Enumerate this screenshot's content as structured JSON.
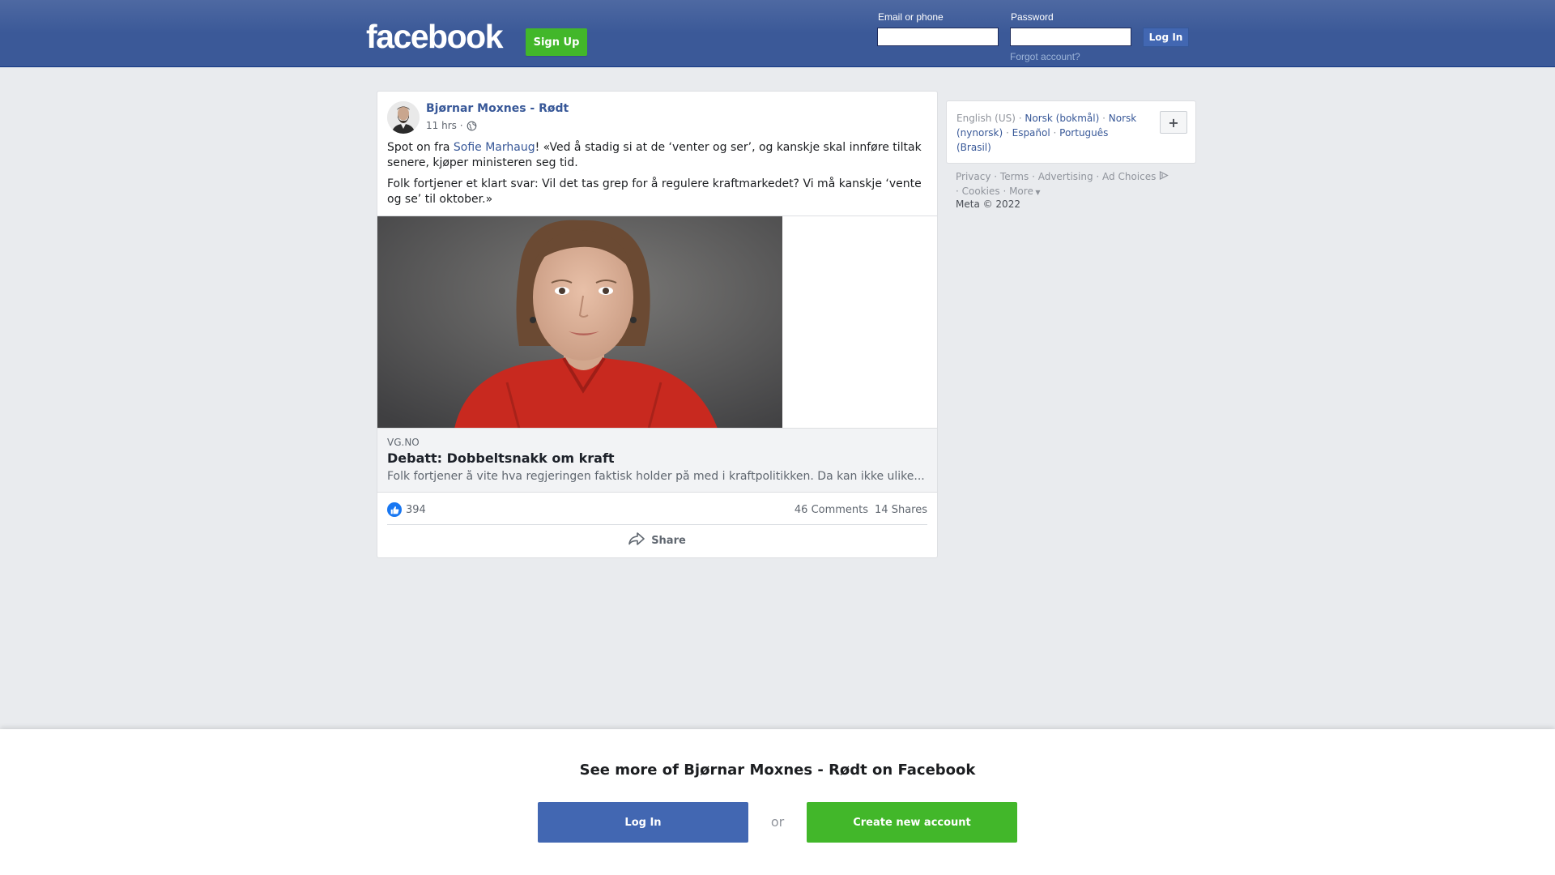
{
  "header": {
    "logo": "facebook",
    "signup_label": "Sign Up",
    "email_label": "Email or phone",
    "password_label": "Password",
    "login_label": "Log In",
    "forgot_label": "Forgot account?"
  },
  "post": {
    "author": "Bjørnar Moxnes - Rødt",
    "time": "11 hrs ·",
    "text_before_mention": "Spot on fra ",
    "mention": "Sofie Marhaug",
    "text_after_mention": "! «Ved å stadig si at de ‘venter og ser’, og kanskje skal innføre tiltak senere, kjøper ministeren seg tid.",
    "paragraph2": "Folk fortjener et klart svar: Vil det tas grep for å regulere kraftmarkedet? Vi må kanskje ‘vente og se’ til oktober.»",
    "link": {
      "domain": "VG.NO",
      "title": "Debatt: Dobbeltsnakk om kraft",
      "description": "Folk fortjener å vite hva regjeringen faktisk holder på med i kraftpolitikken. Da kan ikke ulike..."
    },
    "likes": "394",
    "comments": "46 Comments",
    "shares": "14 Shares",
    "share_label": "Share"
  },
  "languages": {
    "current": "English (US)",
    "options": [
      "Norsk (bokmål)",
      "Norsk (nynorsk)",
      "Español",
      "Português (Brasil)"
    ],
    "plus": "+"
  },
  "footer": {
    "links": [
      "Privacy",
      "Terms",
      "Advertising",
      "Ad Choices",
      "Cookies",
      "More"
    ],
    "copyright": "Meta © 2022"
  },
  "bottom": {
    "title": "See more of Bjørnar Moxnes - Rødt on Facebook",
    "login_label": "Log In",
    "or_label": "or",
    "create_label": "Create new account"
  },
  "colors": {
    "brand": "#3b5998",
    "green": "#42b72a",
    "link": "#385898",
    "like": "#1877f2"
  }
}
